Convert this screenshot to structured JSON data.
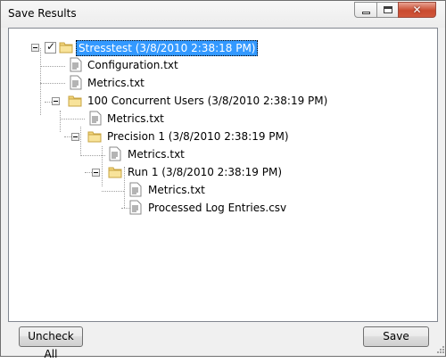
{
  "window": {
    "title": "Save Results",
    "controls": {
      "minimize": "minimize",
      "maximize": "maximize",
      "close": "close"
    }
  },
  "tree": {
    "nodes": [
      {
        "label": "Stresstest (3/8/2010 2:38:18 PM)",
        "type": "folder",
        "checked": true,
        "selected": true
      },
      {
        "label": "Configuration.txt",
        "type": "file"
      },
      {
        "label": "Metrics.txt",
        "type": "file"
      },
      {
        "label": "100 Concurrent Users (3/8/2010 2:38:19 PM)",
        "type": "folder"
      },
      {
        "label": "Metrics.txt",
        "type": "file"
      },
      {
        "label": "Precision 1 (3/8/2010 2:38:19 PM)",
        "type": "folder"
      },
      {
        "label": "Metrics.txt",
        "type": "file"
      },
      {
        "label": "Run 1 (3/8/2010 2:38:19 PM)",
        "type": "folder"
      },
      {
        "label": "Metrics.txt",
        "type": "file"
      },
      {
        "label": "Processed Log Entries.csv",
        "type": "file"
      }
    ]
  },
  "buttons": {
    "uncheck_all": "Uncheck All",
    "save": "Save"
  },
  "colors": {
    "selection": "#3399ff",
    "folder": "#f2d57a",
    "close_button": "#c94a2f"
  }
}
